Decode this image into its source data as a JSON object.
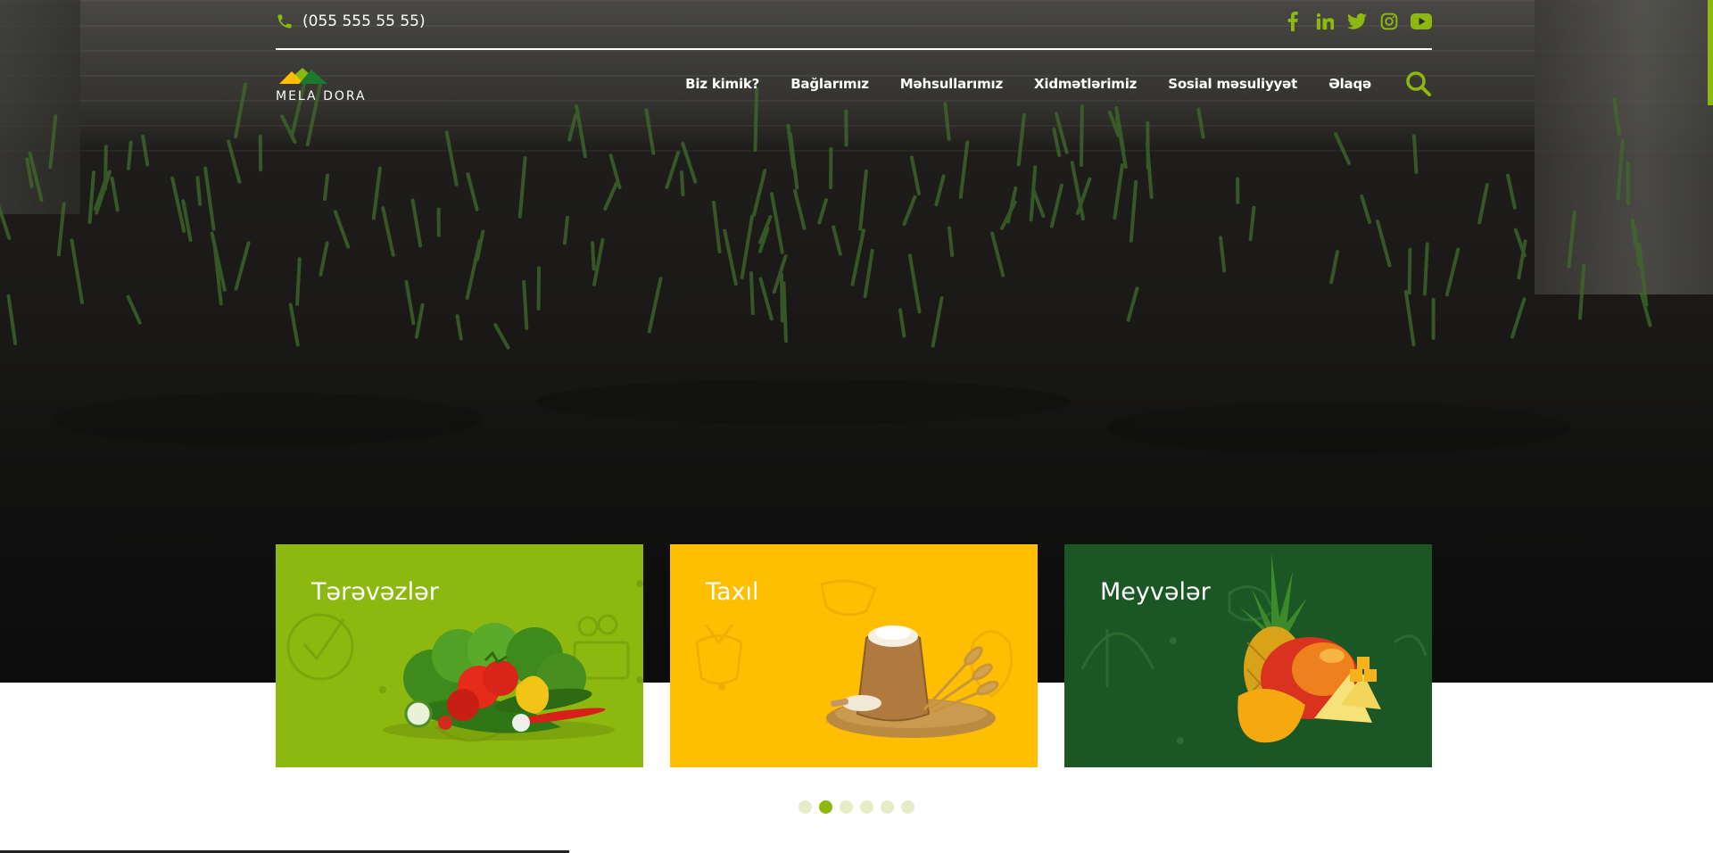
{
  "topbar": {
    "phone": "(055 555 55 55)",
    "socials": [
      "facebook-icon",
      "linkedin-icon",
      "twitter-icon",
      "instagram-icon",
      "youtube-icon"
    ]
  },
  "brand": {
    "name": "MELA DORA",
    "colors": {
      "green": "#8cb80f",
      "yellow": "#ffbf00",
      "dark_green": "#1b5724"
    }
  },
  "nav": {
    "items": [
      "Biz kimik?",
      "Bağlarımız",
      "Məhsullarımız",
      "Xidmətlərimiz",
      "Sosial məsuliyyət",
      "Əlaqə"
    ]
  },
  "categories": [
    {
      "title": "Tərəvəzlər",
      "color": "#8cb80f",
      "image": "vegetables"
    },
    {
      "title": "Taxıl",
      "color": "#ffbf00",
      "image": "grain-sack"
    },
    {
      "title": "Meyvələr",
      "color": "#1b5724",
      "image": "tropical-fruits"
    }
  ],
  "carousel": {
    "slides": 6,
    "active": 2
  }
}
